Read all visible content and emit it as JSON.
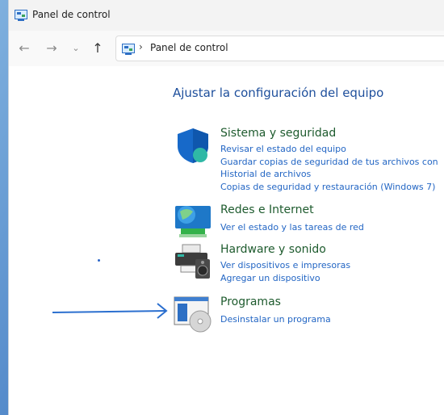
{
  "window": {
    "title": "Panel de control"
  },
  "address": {
    "path": "Panel de control"
  },
  "heading": "Ajustar la configuración del equipo",
  "categories": [
    {
      "title": "Sistema y seguridad",
      "icon": "shield-icon",
      "links": [
        "Revisar el estado del equipo",
        "Guardar copias de seguridad de tus archivos con",
        "Historial de archivos",
        "Copias de seguridad y restauración (Windows 7)"
      ]
    },
    {
      "title": "Redes e Internet",
      "icon": "network-globe-icon",
      "links": [
        "Ver el estado y las tareas de red"
      ]
    },
    {
      "title": "Hardware y sonido",
      "icon": "printer-speaker-icon",
      "links": [
        "Ver dispositivos e impresoras",
        "Agregar un dispositivo"
      ]
    },
    {
      "title": "Programas",
      "icon": "programs-disc-icon",
      "links": [
        "Desinstalar un programa"
      ]
    }
  ],
  "colors": {
    "heading": "#1e4f9c",
    "category_title": "#1e5b2e",
    "link": "#2366c4",
    "annotation_arrow": "#2b6fcf"
  }
}
